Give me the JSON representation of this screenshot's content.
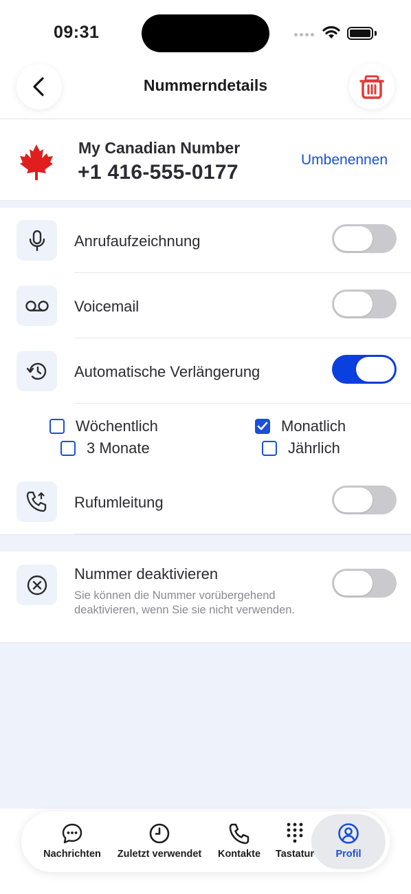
{
  "status_bar": {
    "time": "09:31"
  },
  "header": {
    "title": "Nummerndetails",
    "back_icon": "chevron-left-icon",
    "delete_icon": "trash-icon",
    "delete_color": "#e53935"
  },
  "number": {
    "flag": "canada-flag",
    "name": "My Canadian Number",
    "value": "+1 416-555-0177",
    "rename_label": "Umbenennen"
  },
  "settings": {
    "call_recording": {
      "label": "Anrufaufzeichnung",
      "icon": "microphone-icon",
      "enabled": false
    },
    "voicemail": {
      "label": "Voicemail",
      "icon": "voicemail-icon",
      "enabled": false
    },
    "auto_renew": {
      "label": "Automatische Verlängerung",
      "icon": "history-icon",
      "enabled": true,
      "options": [
        {
          "label": "Wöchentlich",
          "checked": false
        },
        {
          "label": "Monatlich",
          "checked": true
        },
        {
          "label": "3 Monate",
          "checked": false
        },
        {
          "label": "Jährlich",
          "checked": false
        }
      ]
    },
    "call_forwarding": {
      "label": "Rufumleitung",
      "icon": "phone-forward-icon",
      "enabled": false
    }
  },
  "deactivate": {
    "title": "Nummer deaktivieren",
    "description": "Sie können die Nummer vorübergehend deaktivieren, wenn Sie sie nicht verwenden.",
    "icon": "circle-x-icon",
    "enabled": false
  },
  "tabs": [
    {
      "label": "Nachrichten",
      "icon": "message-icon",
      "active": false
    },
    {
      "label": "Zuletzt verwendet",
      "icon": "clock-icon",
      "active": false
    },
    {
      "label": "Kontakte",
      "icon": "phone-icon",
      "active": false
    },
    {
      "label": "Tastatur",
      "icon": "keypad-icon",
      "active": false
    },
    {
      "label": "Profil",
      "icon": "profile-icon",
      "active": true
    }
  ],
  "colors": {
    "accent": "#1a4fd8",
    "toggle_on": "#0a3fe0",
    "toggle_off": "#c9c9ce",
    "background": "#eef3fb"
  }
}
